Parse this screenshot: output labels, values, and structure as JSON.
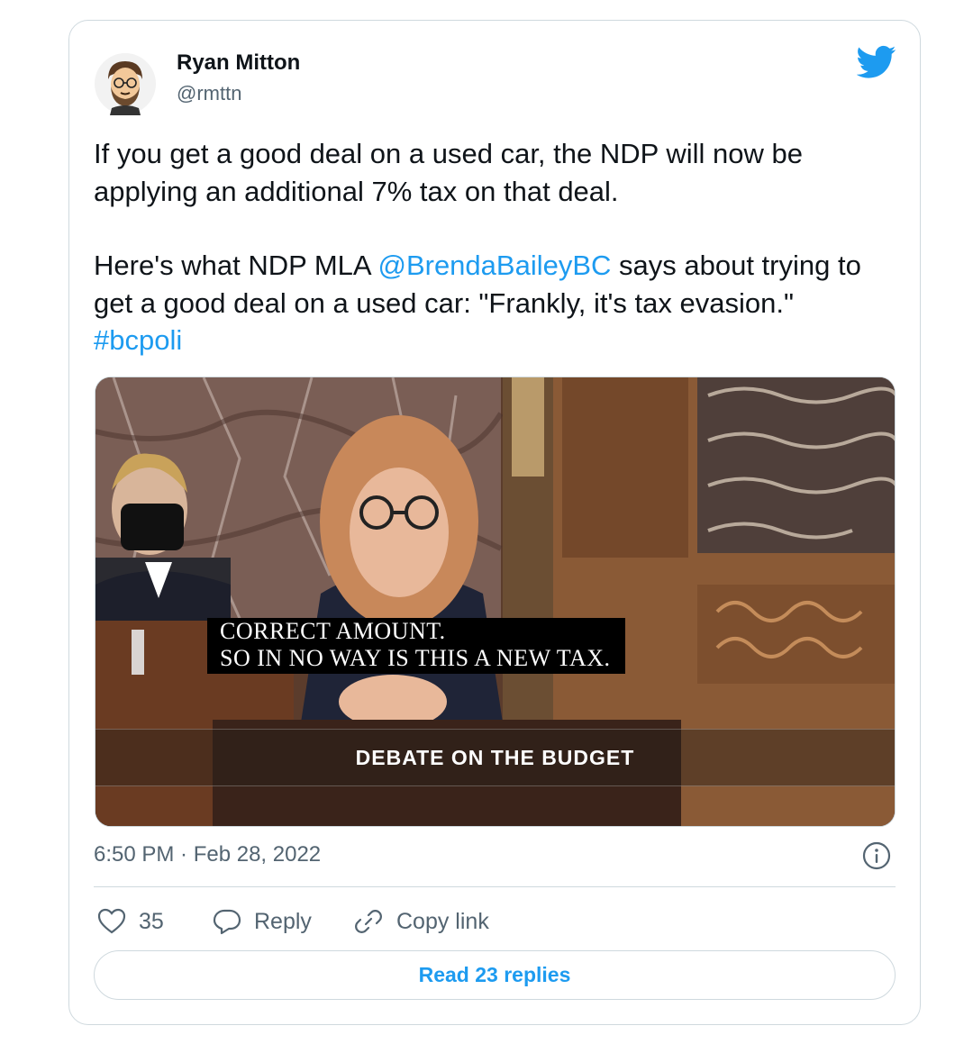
{
  "tweet": {
    "author_name": "Ryan Mitton",
    "author_handle": "@rmttn",
    "text_line1": "If you get a good deal on a used car, the NDP will now be applying an additional 7% tax on that deal.",
    "text_p2_pre": "Here's what NDP MLA ",
    "mention": "@BrendaBaileyBC",
    "text_p2_post": " says about trying to get a good deal on a used car: \"Frankly, it's tax evasion.\"",
    "hashtag": "#bcpoli",
    "timestamp": "6:50 PM · Feb 28, 2022"
  },
  "media": {
    "caption_line1": "CORRECT AMOUNT.",
    "caption_line2": "SO IN NO WAY IS THIS A NEW TAX.",
    "banner": "DEBATE ON THE BUDGET"
  },
  "actions": {
    "like_count": "35",
    "reply_label": "Reply",
    "copy_link_label": "Copy link",
    "read_replies_label": "Read 23 replies"
  },
  "icons": [
    "avatar",
    "twitter-bird-icon",
    "info-icon",
    "heart-icon",
    "reply-icon",
    "link-icon"
  ],
  "colors": {
    "accent": "#1d9bf0",
    "text": "#0f1419",
    "secondary": "#536471",
    "border": "#cfd9de"
  }
}
